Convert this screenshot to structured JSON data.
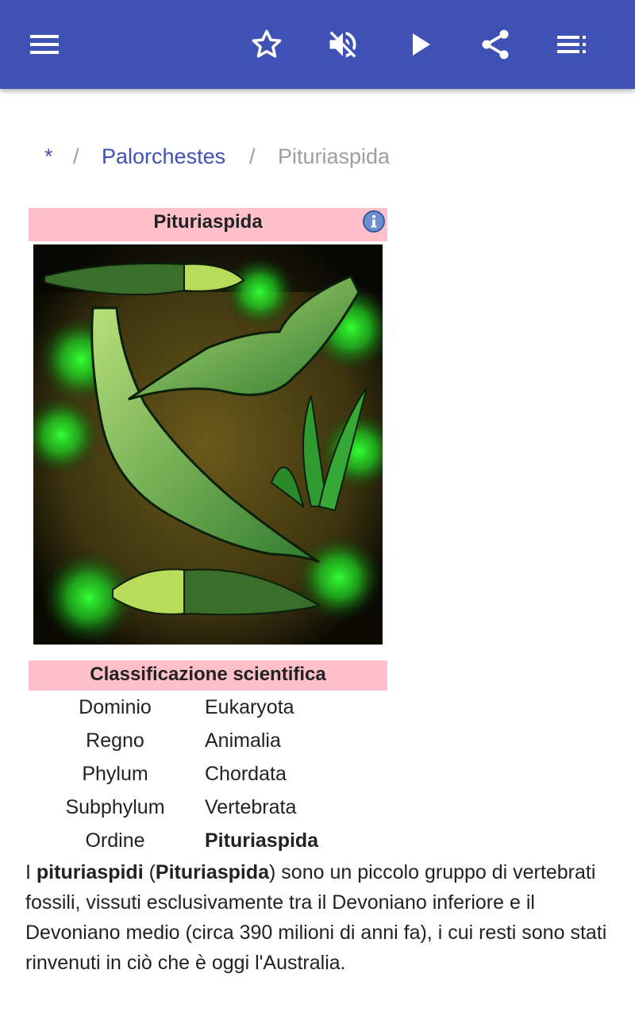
{
  "toolbar": {
    "icons": [
      "menu-icon",
      "star-icon",
      "volume-off-icon",
      "play-icon",
      "share-icon",
      "playlist-icon"
    ]
  },
  "breadcrumb": {
    "root": "*",
    "separator": "/",
    "parent": "Palorchestes",
    "current": "Pituriaspida"
  },
  "infobox": {
    "title": "Pituriaspida",
    "classification_title": "Classificazione scientifica",
    "taxonomy": [
      {
        "rank": "Dominio",
        "value": "Eukaryota"
      },
      {
        "rank": "Regno",
        "value": "Animalia"
      },
      {
        "rank": "Phylum",
        "value": "Chordata"
      },
      {
        "rank": "Subphylum",
        "value": "Vertebrata"
      },
      {
        "rank": "Ordine",
        "value": "Pituriaspida"
      }
    ]
  },
  "article": {
    "p1_start": "I ",
    "p1_bold1": "pituriaspidi",
    "p1_mid": " (",
    "p1_bold2": "Pituriaspida",
    "p1_rest": ") sono un piccolo gruppo di vertebrati fossili, vissuti esclusivamente tra il Devoniano inferiore e il Devoniano medio (circa 390 milioni di anni fa), i cui resti sono stati rinvenuti in ciò che è oggi l'Australia."
  },
  "colors": {
    "appbar": "#3f51b5",
    "infobox_header": "#ffc0cb",
    "link": "#3f51b5"
  }
}
